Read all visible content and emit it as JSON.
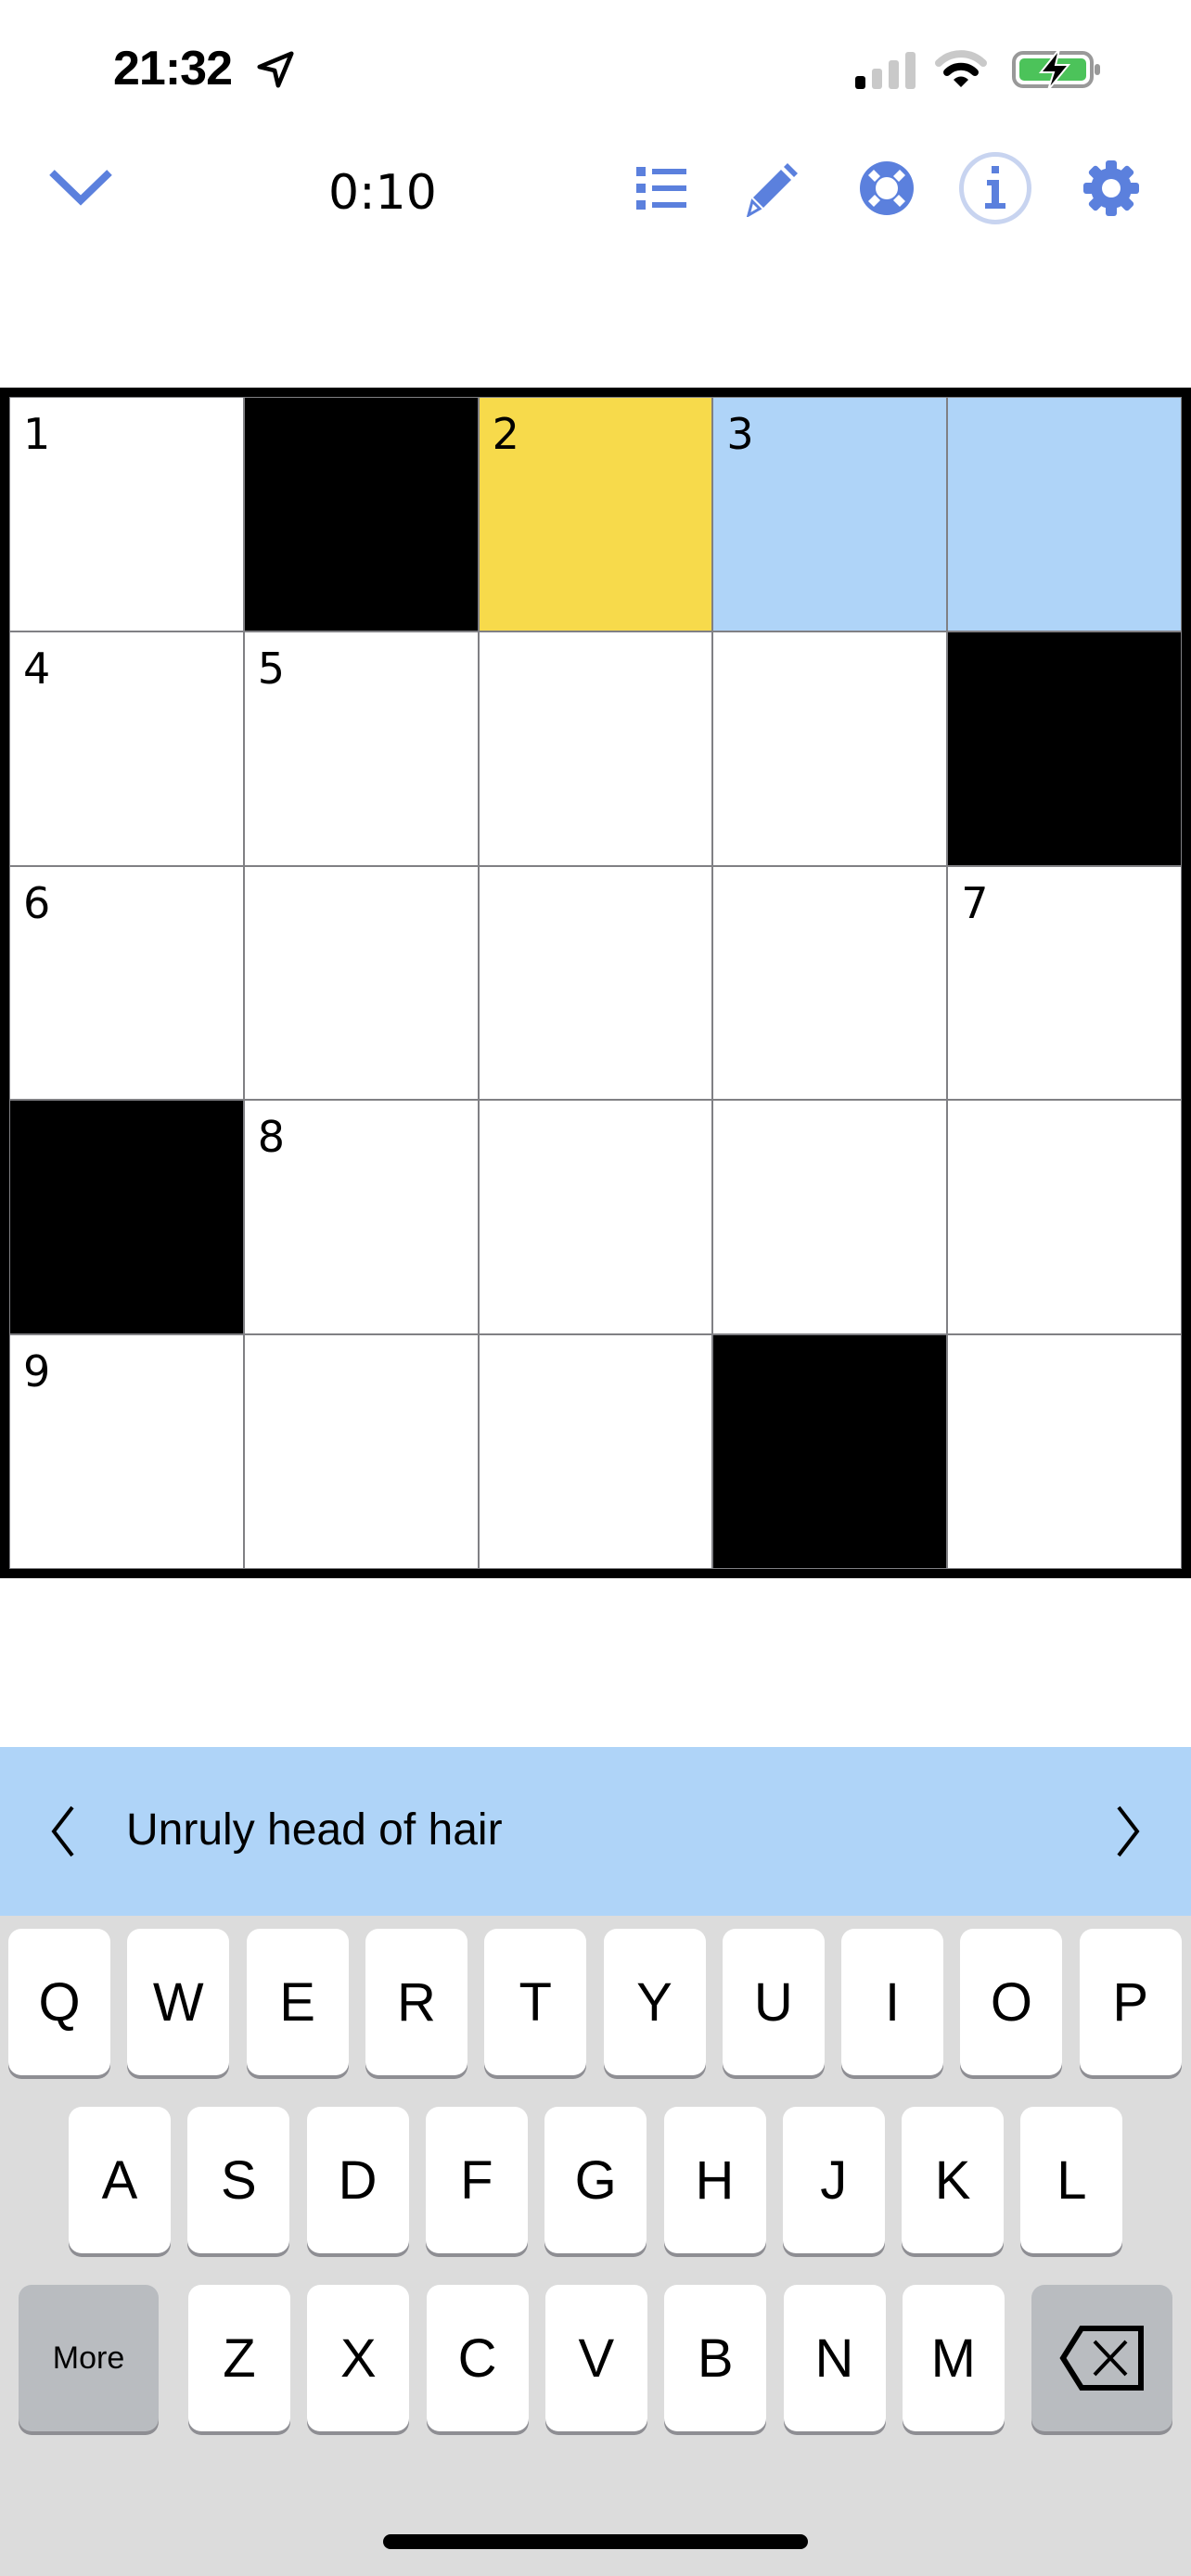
{
  "status_bar": {
    "time": "21:32",
    "location_icon": "location-arrow-icon",
    "signal_icon": "cellular-signal-icon",
    "signal_bars_active": 1,
    "signal_bars_total": 4,
    "wifi_icon": "wifi-icon",
    "battery_icon": "battery-charging-icon",
    "battery_color": "#4cc35a"
  },
  "toolbar": {
    "collapse_icon": "chevron-down-icon",
    "timer": "0:10",
    "accent_color": "#5b80dd",
    "tools": [
      {
        "name": "clue-list",
        "icon": "list-icon"
      },
      {
        "name": "pencil",
        "icon": "pencil-icon"
      },
      {
        "name": "help",
        "icon": "lifebuoy-icon"
      },
      {
        "name": "info",
        "icon": "info-icon"
      },
      {
        "name": "settings",
        "icon": "gear-icon"
      }
    ]
  },
  "puzzle": {
    "size": 5,
    "colors": {
      "selected": "#f7da4b",
      "highlight": "#afd4f8",
      "block": "#000000",
      "empty": "#ffffff"
    },
    "cells": [
      [
        {
          "n": "1"
        },
        {
          "black": true
        },
        {
          "n": "2",
          "state": "selected"
        },
        {
          "n": "3",
          "state": "highlight"
        },
        {
          "state": "highlight"
        }
      ],
      [
        {
          "n": "4"
        },
        {
          "n": "5"
        },
        {},
        {},
        {
          "black": true
        }
      ],
      [
        {
          "n": "6"
        },
        {},
        {},
        {},
        {
          "n": "7"
        }
      ],
      [
        {
          "black": true
        },
        {
          "n": "8"
        },
        {},
        {},
        {}
      ],
      [
        {
          "n": "9"
        },
        {},
        {},
        {
          "black": true
        },
        {}
      ]
    ]
  },
  "clue_bar": {
    "prev_icon": "chevron-left-icon",
    "next_icon": "chevron-right-icon",
    "clue": "Unruly head of hair"
  },
  "keyboard": {
    "rows": [
      [
        "Q",
        "W",
        "E",
        "R",
        "T",
        "Y",
        "U",
        "I",
        "O",
        "P"
      ],
      [
        "A",
        "S",
        "D",
        "F",
        "G",
        "H",
        "J",
        "K",
        "L"
      ],
      [
        "Z",
        "X",
        "C",
        "V",
        "B",
        "N",
        "M"
      ]
    ],
    "more_label": "More",
    "delete_icon": "backspace-icon"
  }
}
